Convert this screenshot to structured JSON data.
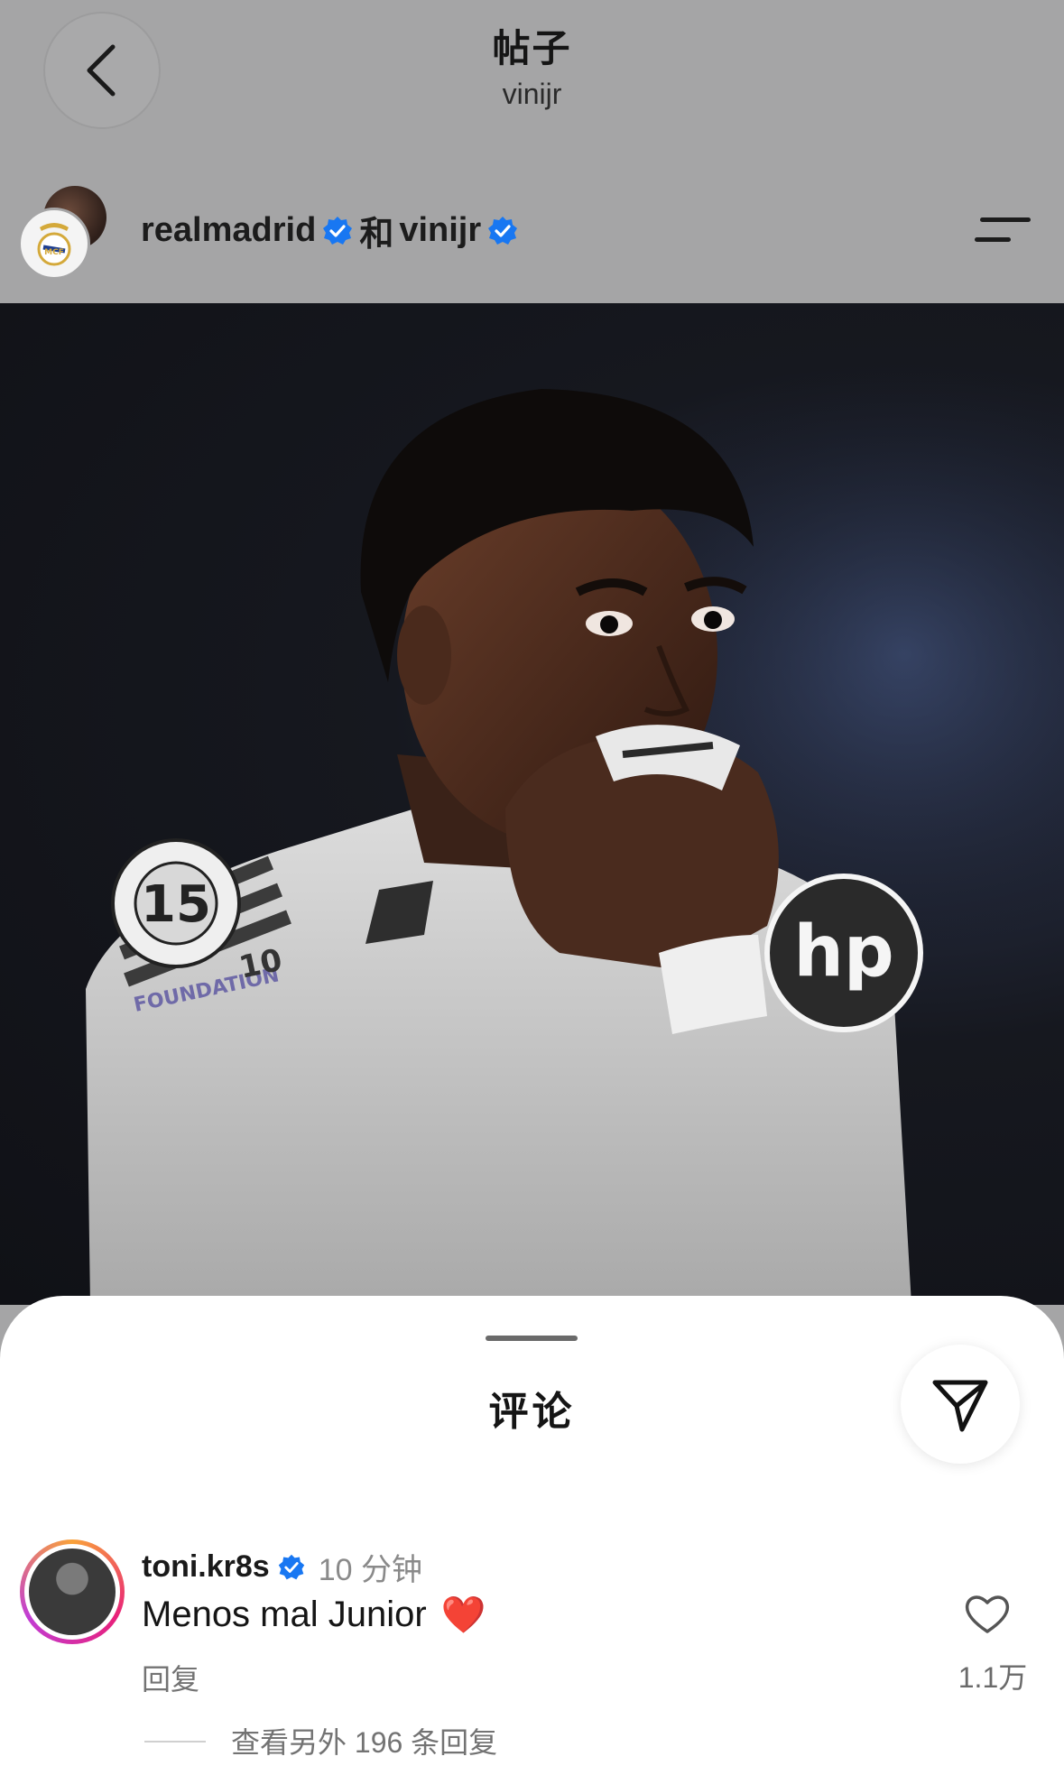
{
  "header": {
    "title": "帖子",
    "subtitle": "vinijr",
    "author_1": "realmadrid",
    "connector": "和",
    "author_2": "vinijr",
    "back_icon": "chevron-left-icon",
    "menu_icon": "menu-icon"
  },
  "photo": {
    "badge_number": "15",
    "foundation_text": "FOUNDATION",
    "foundation_number": "10"
  },
  "comments": {
    "title": "评论",
    "share_icon": "send-icon",
    "items": [
      {
        "username": "toni.kr8s",
        "time": "10 分钟",
        "text": "Menos mal Junior",
        "emoji": "❤️",
        "reply_label": "回复",
        "like_count": "1.1万",
        "view_more": "查看另外 196 条回复"
      }
    ]
  },
  "colors": {
    "verified_blue": "#1877f2",
    "header_bg": "#a5a5a6",
    "heart_red": "#e0242b"
  }
}
